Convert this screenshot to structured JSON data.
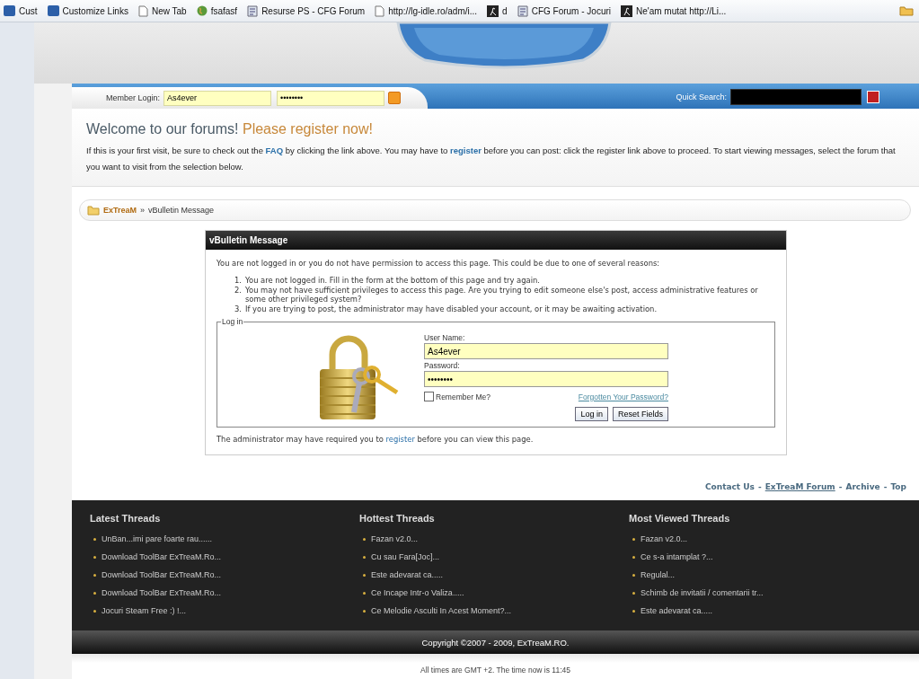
{
  "bookmarks": [
    {
      "label": "Cust",
      "kind": "m"
    },
    {
      "label": "Customize Links",
      "kind": "m"
    },
    {
      "label": "New Tab",
      "kind": "page"
    },
    {
      "label": "fsafasf",
      "kind": "globe"
    },
    {
      "label": "Resurse PS - CFG Forum",
      "kind": "doc"
    },
    {
      "label": "http://lg-idle.ro/adm/i...",
      "kind": "page"
    },
    {
      "label": "d",
      "kind": "k"
    },
    {
      "label": "CFG Forum - Jocuri",
      "kind": "doc"
    },
    {
      "label": "Ne'am mutat http://Li...",
      "kind": "k"
    }
  ],
  "member_login": {
    "label": "Member Login:",
    "username": "As4ever",
    "password": "••••••••"
  },
  "quick_search": {
    "label": "Quick Search:"
  },
  "welcome": {
    "title": "Welcome to our forums!",
    "highlight": "Please register now!",
    "parts": [
      {
        "kind": "text",
        "text": "If this is your first visit, be sure to check out the "
      },
      {
        "kind": "link",
        "text": "FAQ"
      },
      {
        "kind": "text",
        "text": " by clicking the link above. You may have to "
      },
      {
        "kind": "link",
        "text": "register"
      },
      {
        "kind": "text",
        "text": " before you can post: click the register link above to proceed. To start viewing messages, select the forum that you want to visit from the selection below."
      }
    ]
  },
  "breadcrumb": {
    "home": "ExTreaM",
    "separator": "»",
    "current": "vBulletin Message"
  },
  "message": {
    "title": "vBulletin Message",
    "intro": "You are not logged in or you do not have permission to access this page. This could be due to one of several reasons:",
    "reasons": [
      {
        "number": "1.",
        "text": "You are not logged in. Fill in the form at the bottom of this page and try again."
      },
      {
        "number": "2.",
        "text": "You may not have sufficient privileges to access this page. Are you trying to edit someone else's post, access administrative features or some other privileged system?"
      },
      {
        "number": "3.",
        "text": "If you are trying to post, the administrator may have disabled your account, or it may be awaiting activation."
      }
    ],
    "login": {
      "legend": "Log in",
      "user_label": "User Name:",
      "user_value": "As4ever",
      "pass_label": "Password:",
      "pass_value": "••••••••",
      "remember_label": "Remember Me?",
      "remember_checked": false,
      "forgot": "Forgotten Your Password?",
      "buttons": [
        "Log in",
        "Reset Fields"
      ]
    },
    "note_parts": [
      {
        "kind": "text",
        "text": "The administrator may have required you to "
      },
      {
        "kind": "link",
        "text": "register"
      },
      {
        "kind": "text",
        "text": " before you can view this page."
      }
    ]
  },
  "footer_separator": "-",
  "footer_links": [
    {
      "text": "Contact Us",
      "underlined": false
    },
    {
      "text": "ExTreaM Forum",
      "underlined": true
    },
    {
      "text": "Archive",
      "underlined": false
    },
    {
      "text": "Top",
      "underlined": false
    }
  ],
  "thread_columns": [
    {
      "title": "Latest Threads",
      "items": [
        "UnBan...imi pare foarte rau......",
        "Download ToolBar ExTreaM.Ro...",
        "Download ToolBar ExTreaM.Ro...",
        "Download ToolBar ExTreaM.Ro...",
        "Jocuri Steam Free :) !..."
      ]
    },
    {
      "title": "Hottest Threads",
      "items": [
        "Fazan v2.0...",
        "Cu sau Fara[Joc]...",
        "Este adevarat ca.....",
        "Ce Incape Intr-o Valiza.....",
        "Ce Melodie Asculti In Acest Moment?..."
      ]
    },
    {
      "title": "Most Viewed Threads",
      "items": [
        "Fazan v2.0...",
        "Ce s-a intamplat ?...",
        "Regulal...",
        "Schimb de invitatii / comentarii tr...",
        "Este adevarat ca....."
      ]
    }
  ],
  "copyright": "Copyright ©2007 - 2009, ExTreaM.RO.",
  "time_note": "All times are GMT +2. The time now is 11:45"
}
